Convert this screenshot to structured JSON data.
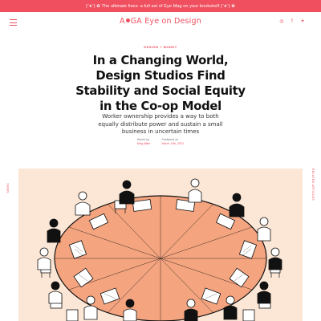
{
  "promo": {
    "text": "(ᵔᴥᵔ) ✿ The ultimate fixes: a full set of Eye Mag on your bookshelf (ᵔᴥᵔ) ✿"
  },
  "header": {
    "logo_prefix": "A",
    "logo_mid": "GA",
    "logo_suffix": "Eye on Design",
    "social": [
      "instagram-icon",
      "facebook-icon",
      "twitter-icon"
    ]
  },
  "article": {
    "category": "DESIGN + MONEY",
    "title": "In a Changing World, Design Studios Find Stability and Social Equity in the Co-op Model",
    "dek": "Worker ownership provides a way to both equally distribute power and sustain a small business in uncertain times",
    "meta": {
      "words_by_label": "Words by",
      "author": "Meg Miller",
      "published_label": "Published on",
      "date": "March 11th, 2021"
    }
  },
  "side": {
    "left": "NEWS",
    "right": "RELATED ARTICLES"
  },
  "colors": {
    "accent": "#ef4f5f",
    "hero_bg": "#fce7d6",
    "table": "#f4a47f"
  }
}
